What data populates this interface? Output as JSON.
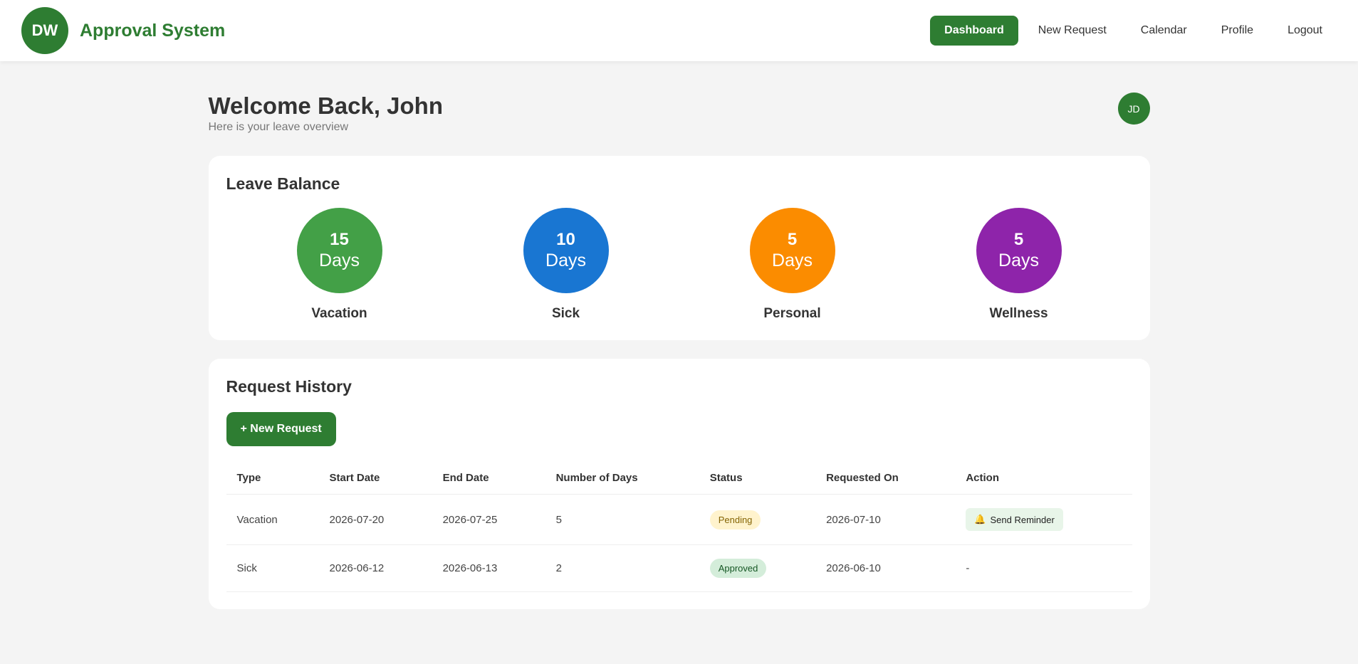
{
  "brand": {
    "logo": "DW",
    "title": "Approval System"
  },
  "nav": [
    {
      "label": "Dashboard",
      "active": true
    },
    {
      "label": "New Request",
      "active": false
    },
    {
      "label": "Calendar",
      "active": false
    },
    {
      "label": "Profile",
      "active": false
    },
    {
      "label": "Logout",
      "active": false
    }
  ],
  "welcome": {
    "title": "Welcome Back, John",
    "subtitle": "Here is your leave overview",
    "avatar": "JD"
  },
  "balance": {
    "title": "Leave Balance",
    "items": [
      {
        "value": "15",
        "unit": "Days",
        "label": "Vacation",
        "color": "#43a047"
      },
      {
        "value": "10",
        "unit": "Days",
        "label": "Sick",
        "color": "#1976d2"
      },
      {
        "value": "5",
        "unit": "Days",
        "label": "Personal",
        "color": "#fb8c00"
      },
      {
        "value": "5",
        "unit": "Days",
        "label": "Wellness",
        "color": "#8e24aa"
      }
    ]
  },
  "history": {
    "title": "Request History",
    "new_button": "+ New Request",
    "columns": [
      "Type",
      "Start Date",
      "End Date",
      "Number of Days",
      "Status",
      "Requested On",
      "Action"
    ],
    "rows": [
      {
        "type": "Vacation",
        "start": "2026-07-20",
        "end": "2026-07-25",
        "days": "5",
        "status": "Pending",
        "requested": "2026-07-10",
        "action": "Send Reminder"
      },
      {
        "type": "Sick",
        "start": "2026-06-12",
        "end": "2026-06-13",
        "days": "2",
        "status": "Approved",
        "requested": "2026-06-10",
        "action": "-"
      }
    ]
  },
  "icons": {
    "bell": "bell-icon"
  },
  "colors": {
    "brand": "#2e7d32",
    "pending_bg": "#fff3cd",
    "approved_bg": "#d4edda"
  }
}
